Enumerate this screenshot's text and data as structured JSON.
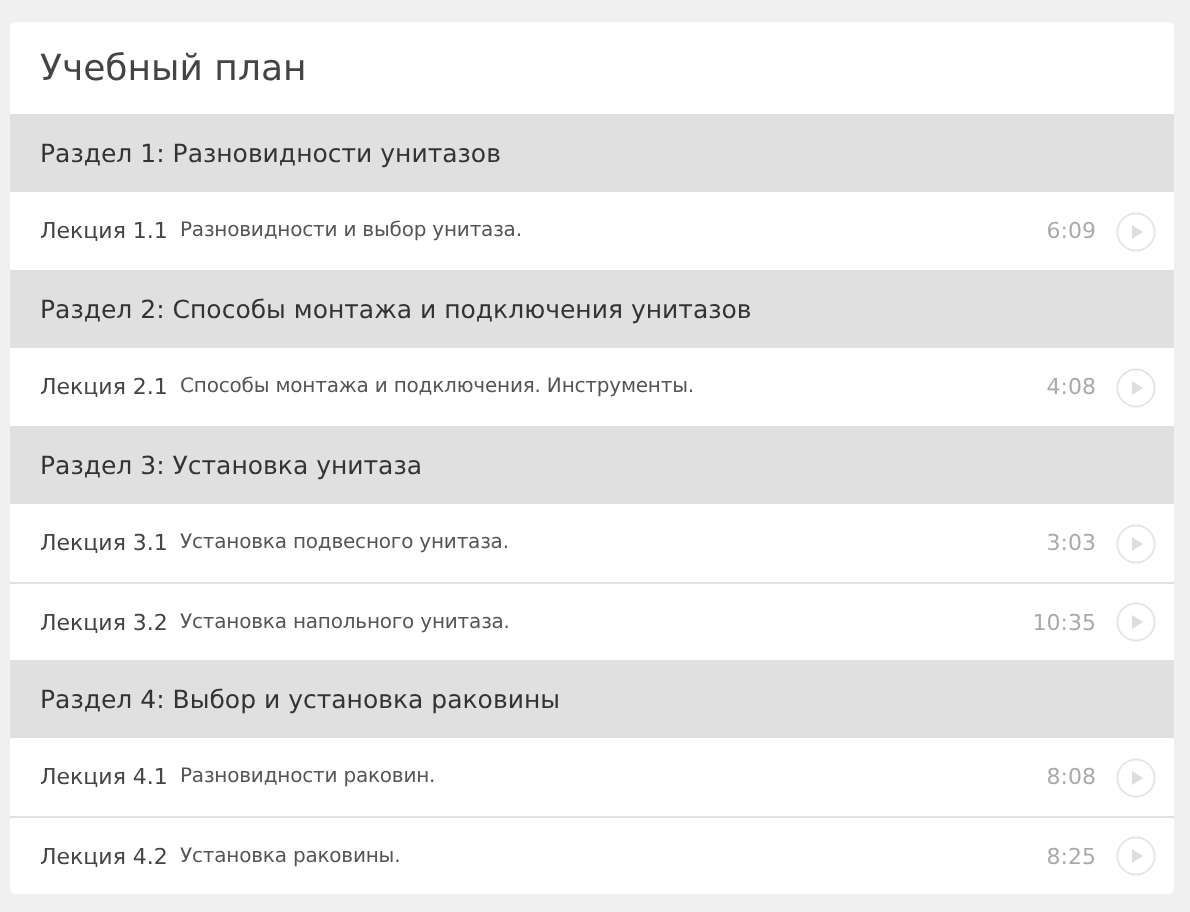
{
  "title": "Учебный план",
  "sections": [
    {
      "title": "Раздел 1: Разновидности унитазов",
      "lectures": [
        {
          "label": "Лекция 1.1",
          "name": "Разновидности и выбор унитаза.",
          "duration": "6:09"
        }
      ]
    },
    {
      "title": "Раздел 2: Способы монтажа и подключения унитазов",
      "lectures": [
        {
          "label": "Лекция 2.1",
          "name": "Способы монтажа и подключения. Инструменты.",
          "duration": "4:08"
        }
      ]
    },
    {
      "title": "Раздел 3: Установка унитаза",
      "lectures": [
        {
          "label": "Лекция 3.1",
          "name": "Установка подвесного унитаза.",
          "duration": "3:03"
        },
        {
          "label": "Лекция 3.2",
          "name": "Установка напольного унитаза.",
          "duration": "10:35"
        }
      ]
    },
    {
      "title": "Раздел 4: Выбор и установка раковины",
      "lectures": [
        {
          "label": "Лекция 4.1",
          "name": "Разновидности раковин.",
          "duration": "8:08"
        },
        {
          "label": "Лекция 4.2",
          "name": "Установка раковины.",
          "duration": "8:25"
        }
      ]
    }
  ]
}
